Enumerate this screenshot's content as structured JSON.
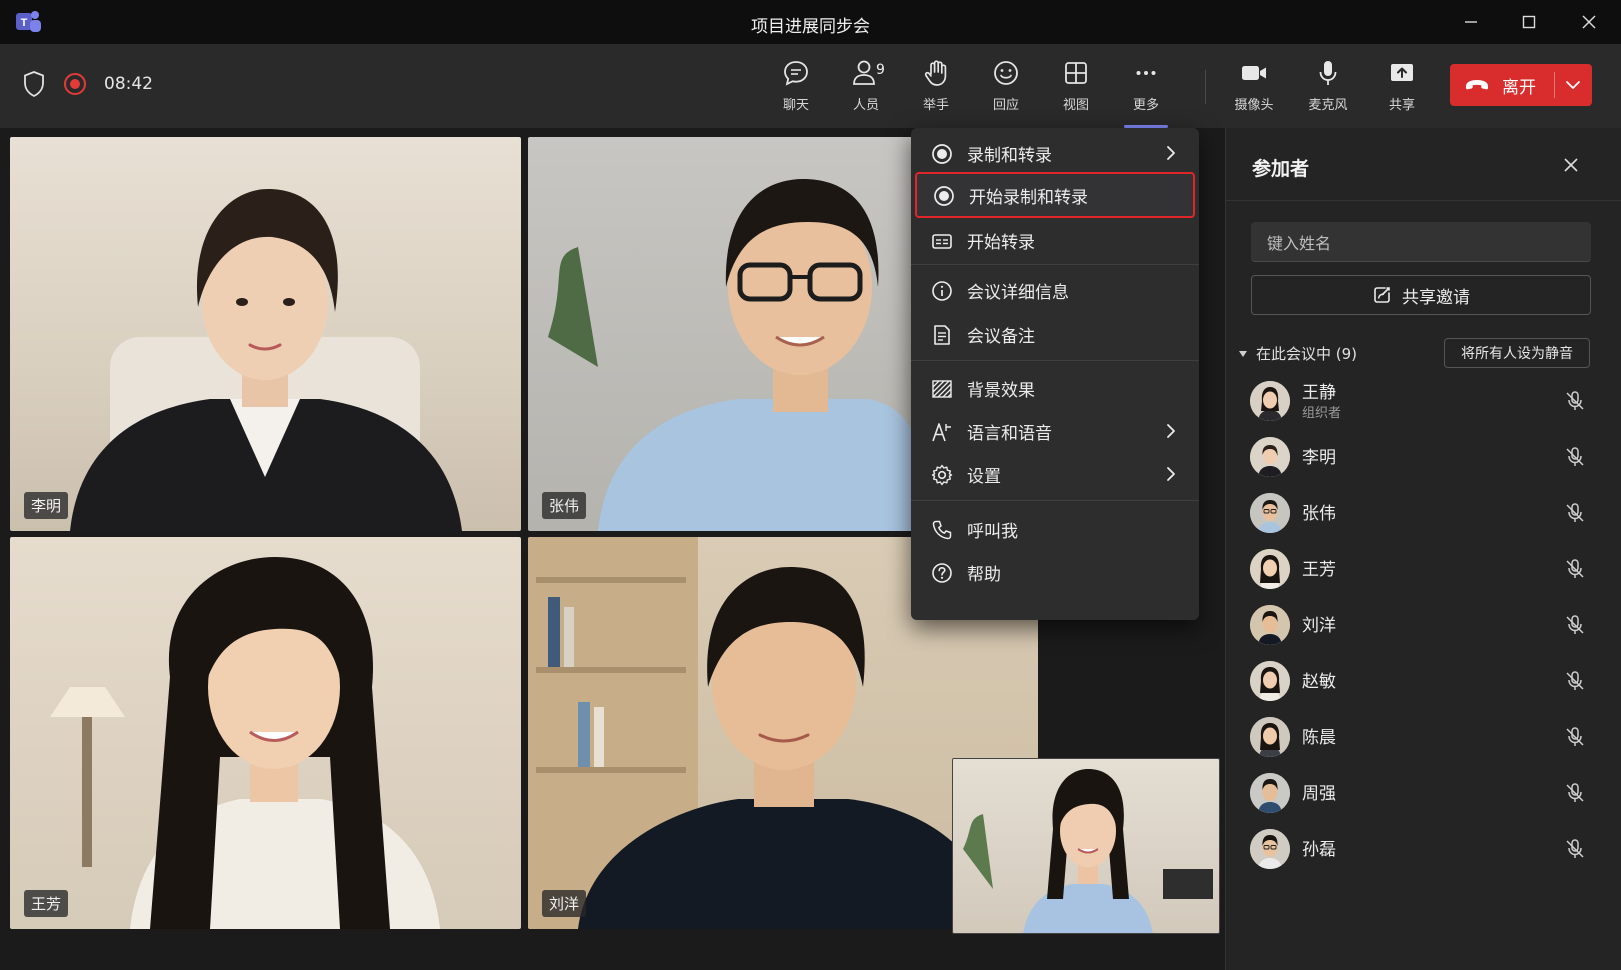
{
  "window": {
    "title": "项目进展同步会"
  },
  "toolbar": {
    "timer": "08:42",
    "items": [
      {
        "label": "聊天",
        "icon": "chat-icon"
      },
      {
        "label": "人员",
        "icon": "people-icon",
        "badge": "9"
      },
      {
        "label": "举手",
        "icon": "raise-hand-icon"
      },
      {
        "label": "回应",
        "icon": "react-icon"
      },
      {
        "label": "视图",
        "icon": "view-grid-icon"
      },
      {
        "label": "更多",
        "icon": "more-icon",
        "active": true
      },
      {
        "label": "摄像头",
        "icon": "camera-icon"
      },
      {
        "label": "麦克风",
        "icon": "mic-icon"
      },
      {
        "label": "共享",
        "icon": "share-icon"
      }
    ],
    "leave_label": "离开",
    "accent": "#7f85f5",
    "leave_color": "#d92c2c"
  },
  "videos": [
    {
      "name": "李明"
    },
    {
      "name": "张伟"
    },
    {
      "name": "王芳"
    },
    {
      "name": "刘洋"
    }
  ],
  "menu": {
    "items": [
      {
        "label": "录制和转录",
        "icon": "record-icon",
        "submenu": true
      },
      {
        "label": "开始录制和转录",
        "icon": "record-icon",
        "highlight": true
      },
      {
        "label": "开始转录",
        "icon": "transcript-icon"
      },
      {
        "label": "会议详细信息",
        "icon": "info-icon"
      },
      {
        "label": "会议备注",
        "icon": "notes-icon"
      },
      {
        "label": "背景效果",
        "icon": "background-effects-icon"
      },
      {
        "label": "语言和语音",
        "icon": "language-icon",
        "submenu": true
      },
      {
        "label": "设置",
        "icon": "settings-icon",
        "submenu": true
      },
      {
        "label": "呼叫我",
        "icon": "phone-icon"
      },
      {
        "label": "帮助",
        "icon": "help-icon"
      }
    ],
    "highlight_color": "#e0262b"
  },
  "panel": {
    "title": "参加者",
    "search_placeholder": "键入姓名",
    "share_invite_label": "共享邀请",
    "section_label": "在此会议中 (9)",
    "mute_all_label": "将所有人设为静音",
    "participants": [
      {
        "name": "王静",
        "role": "组织者"
      },
      {
        "name": "李明"
      },
      {
        "name": "张伟"
      },
      {
        "name": "王芳"
      },
      {
        "name": "刘洋"
      },
      {
        "name": "赵敏"
      },
      {
        "name": "陈晨"
      },
      {
        "name": "周强"
      },
      {
        "name": "孙磊"
      }
    ]
  }
}
